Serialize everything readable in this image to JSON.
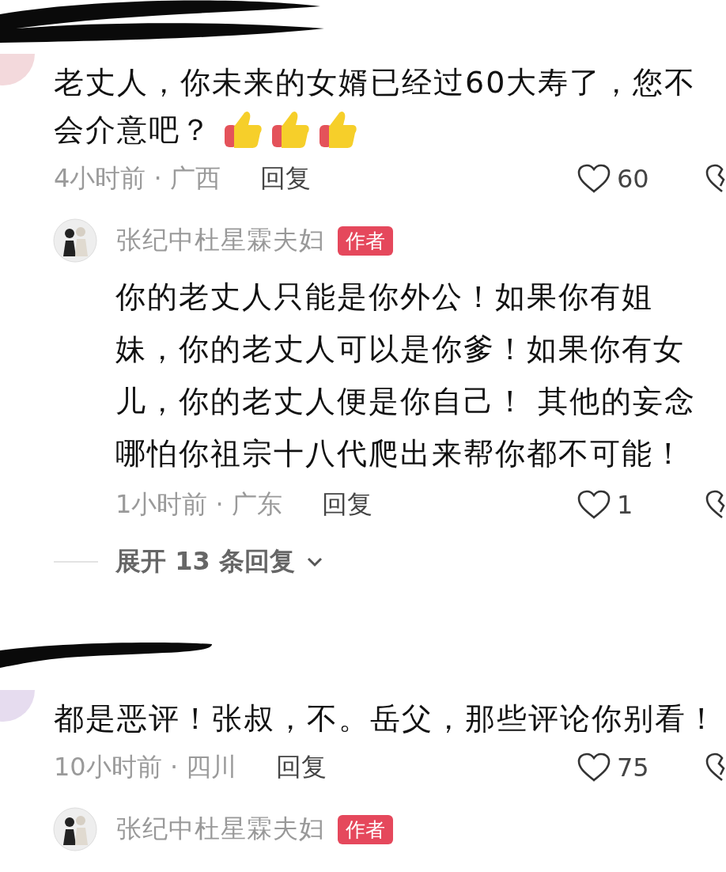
{
  "comments": [
    {
      "redacted": true,
      "text": "老丈人，你未来的女婿已经过60大寿了，您不会介意吧？",
      "emojis": [
        {
          "kind": "thumbs-up"
        },
        {
          "kind": "thumbs-up"
        },
        {
          "kind": "thumbs-up"
        }
      ],
      "meta": "4小时前 · 广西",
      "reply": "回复",
      "likes": "60",
      "replies": [
        {
          "author": "张纪中杜星霖夫妇",
          "badge": "作者",
          "text": "你的老丈人只能是你外公！如果你有姐妹，你的老丈人可以是你爹！如果你有女儿，你的老丈人便是你自己！ 其他的妄念哪怕你祖宗十八代爬出来帮你都不可能！",
          "meta": "1小时前 · 广东",
          "reply": "回复",
          "likes": "1"
        }
      ],
      "expand": "展开 13 条回复"
    },
    {
      "redacted": true,
      "text": "都是恶评！张叔，不。岳父，那些评论你别看！",
      "meta": "10小时前 · 四川",
      "reply": "回复",
      "likes": "75",
      "replies": [
        {
          "author": "张纪中杜星霖夫妇",
          "badge": "作者"
        }
      ]
    }
  ]
}
